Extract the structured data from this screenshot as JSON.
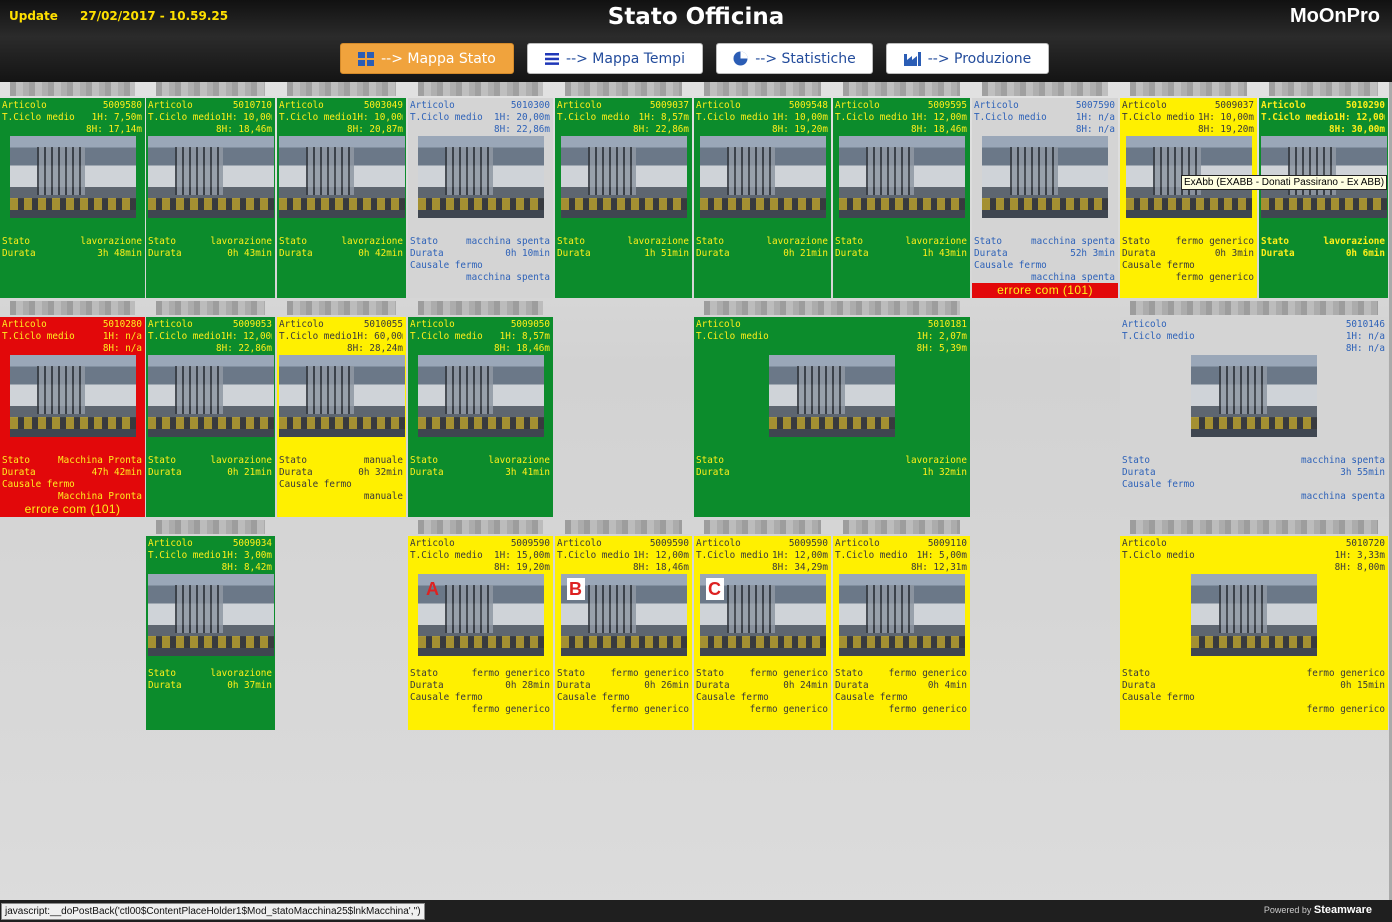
{
  "header": {
    "update_label": "Update",
    "timestamp": "27/02/2017 - 10.59.25",
    "title": "Stato Officina",
    "logo": "MoOnPro"
  },
  "nav": [
    {
      "label": "--> Mappa Stato",
      "icon": "grid-icon",
      "active": true
    },
    {
      "label": "--> Mappa Tempi",
      "icon": "list-icon",
      "active": false
    },
    {
      "label": "--> Statistiche",
      "icon": "pie-chart-icon",
      "active": false
    },
    {
      "label": "--> Produzione",
      "icon": "factory-icon",
      "active": false
    }
  ],
  "labels": {
    "articolo": "Articolo",
    "tciclo": "T.Ciclo medio",
    "stato": "Stato",
    "durata": "Durata",
    "causale": "Causale fermo"
  },
  "machines": [
    {
      "color": "green",
      "articolo": "5009580",
      "h1": "1H: 7,50m",
      "h8": "8H: 17,14m",
      "stato": "lavorazione",
      "durata": "3h 48min"
    },
    {
      "color": "green",
      "articolo": "5010710",
      "h1": "1H: 10,00m",
      "h8": "8H: 18,46m",
      "stato": "lavorazione",
      "durata": "0h 43min"
    },
    {
      "color": "green",
      "articolo": "5003049",
      "h1": "1H: 10,00m",
      "h8": "8H: 20,87m",
      "stato": "lavorazione",
      "durata": "0h 42min"
    },
    {
      "color": "gray",
      "articolo": "5010300",
      "h1": "1H: 20,00m",
      "h8": "8H: 22,86m",
      "stato": "macchina spenta",
      "durata": "0h 10min",
      "causale": "macchina spenta"
    },
    {
      "color": "green",
      "articolo": "5009037",
      "h1": "1H: 8,57m",
      "h8": "8H: 22,86m",
      "stato": "lavorazione",
      "durata": "1h 51min"
    },
    {
      "color": "green",
      "articolo": "5009548",
      "h1": "1H: 10,00m",
      "h8": "8H: 19,20m",
      "stato": "lavorazione",
      "durata": "0h 21min"
    },
    {
      "color": "green",
      "articolo": "5009595",
      "h1": "1H: 12,00m",
      "h8": "8H: 18,46m",
      "stato": "lavorazione",
      "durata": "1h 43min"
    },
    {
      "color": "gray",
      "articolo": "5007590",
      "h1": "1H: n/a",
      "h8": "8H: n/a",
      "stato": "macchina spenta",
      "durata": "52h 3min",
      "causale": "macchina spenta",
      "error": "errore com (101)"
    },
    {
      "color": "yellow",
      "articolo": "5009037",
      "h1": "1H: 10,00m",
      "h8": "8H: 19,20m",
      "stato": "fermo generico",
      "durata": "0h 3min",
      "causale": "fermo generico"
    },
    {
      "color": "green",
      "articolo": "5010290",
      "h1": "1H: 12,00m",
      "h8": "8H: 30,00m",
      "stato": "lavorazione",
      "durata": "0h 6min",
      "bold": true
    },
    {
      "color": "red",
      "articolo": "5010280",
      "h1": "1H: n/a",
      "h8": "8H: n/a",
      "stato": "Macchina Pronta",
      "durata": "47h 42min",
      "causale": "Macchina Pronta",
      "error": "errore com (101)"
    },
    {
      "color": "green",
      "articolo": "5009053",
      "h1": "1H: 12,00m",
      "h8": "8H: 22,86m",
      "stato": "lavorazione",
      "durata": "0h 21min"
    },
    {
      "color": "yellow",
      "articolo": "5010055",
      "h1": "1H: 60,00m",
      "h8": "8H: 28,24m",
      "stato": "manuale",
      "durata": "0h 32min",
      "causale": "manuale"
    },
    {
      "color": "green",
      "articolo": "5009050",
      "h1": "1H: 8,57m",
      "h8": "8H: 18,46m",
      "stato": "lavorazione",
      "durata": "3h 41min"
    },
    {
      "color": "green",
      "articolo": "5010181",
      "h1": "1H: 2,07m",
      "h8": "8H: 5,39m",
      "stato": "lavorazione",
      "durata": "1h 32min"
    },
    {
      "color": "gray",
      "articolo": "5010146",
      "h1": "1H: n/a",
      "h8": "8H: n/a",
      "stato": "macchina spenta",
      "durata": "3h 55min",
      "causale": "macchina spenta"
    },
    {
      "color": "green",
      "articolo": "5009034",
      "h1": "1H: 3,00m",
      "h8": "8H: 8,42m",
      "stato": "lavorazione",
      "durata": "0h 37min"
    },
    {
      "color": "yellow",
      "articolo": "5009590",
      "h1": "1H: 15,00m",
      "h8": "8H: 19,20m",
      "stato": "fermo generico",
      "durata": "0h 28min",
      "causale": "fermo generico",
      "badge": "A"
    },
    {
      "color": "yellow",
      "articolo": "5009590",
      "h1": "1H: 12,00m",
      "h8": "8H: 18,46m",
      "stato": "fermo generico",
      "durata": "0h 26min",
      "causale": "fermo generico",
      "badge": "B"
    },
    {
      "color": "yellow",
      "articolo": "5009590",
      "h1": "1H: 12,00m",
      "h8": "8H: 34,29m",
      "stato": "fermo generico",
      "durata": "0h 24min",
      "causale": "fermo generico",
      "badge": "C"
    },
    {
      "color": "yellow",
      "articolo": "5009110",
      "h1": "1H: 5,00m",
      "h8": "8H: 12,31m",
      "stato": "fermo generico",
      "durata": "0h 4min",
      "causale": "fermo generico"
    },
    {
      "color": "yellow",
      "articolo": "5010720",
      "h1": "1H: 3,33m",
      "h8": "8H: 8,00m",
      "stato": "fermo generico",
      "durata": "0h 15min",
      "causale": "fermo generico"
    }
  ],
  "tooltip": "ExAbb (EXABB - Donati Passirano - Ex ABB)",
  "statusbar": {
    "url": "javascript:__doPostBack('ctl00$ContentPlaceHolder1$Mod_statoMacchina25$lnkMacchina','')",
    "powered_by": "Powered by",
    "brand": "Steamware"
  }
}
